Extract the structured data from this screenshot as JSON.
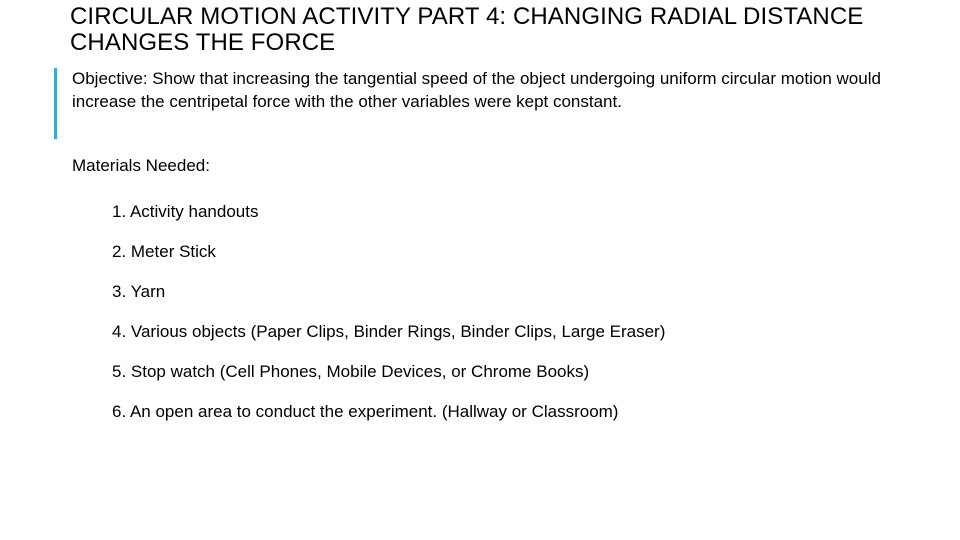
{
  "slide": {
    "title": "CIRCULAR MOTION ACTIVITY PART 4: CHANGING RADIAL DISTANCE CHANGES THE FORCE",
    "accent_color": "#40a7d4",
    "objective": "Objective: Show that increasing the tangential speed of the object undergoing uniform circular motion would increase the centripetal force with the other variables were kept constant.",
    "materials_heading": "Materials Needed:",
    "materials": [
      "1. Activity handouts",
      "2. Meter Stick",
      "3. Yarn",
      "4. Various objects (Paper Clips, Binder Rings, Binder Clips, Large Eraser)",
      "5. Stop watch (Cell Phones, Mobile Devices, or Chrome Books)",
      "6. An open area to conduct the experiment. (Hallway or Classroom)"
    ]
  }
}
